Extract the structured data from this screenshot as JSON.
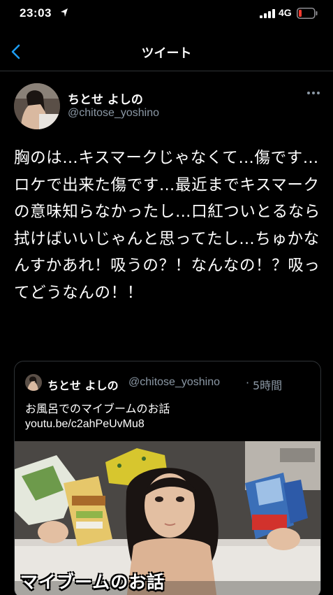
{
  "status_bar": {
    "time": "23:03",
    "network": "4G"
  },
  "nav": {
    "title": "ツイート"
  },
  "tweet": {
    "display_name": "ちとせ よしの",
    "handle": "@chitose_yoshino",
    "text": "胸のは…キスマークじゃなくて…傷です…ロケで出来た傷です…最近までキスマークの意味知らなかったし…口紅ついとるなら拭けばいいじゃんと思ってたし…ちゅかなんすかあれ！吸うの？！なんなの！？吸ってどうなんの！！"
  },
  "quote": {
    "display_name": "ちとせ よしの",
    "handle": "@chitose_yoshino",
    "separator": "·",
    "time": "5時間",
    "text": "お風呂でのマイブームのお話",
    "link": "youtu.be/c2ahPeUvMu8",
    "media_caption": "マイブームのお話"
  },
  "colors": {
    "background": "#000000",
    "text": "#ffffff",
    "secondary_text": "#8b98a5",
    "accent": "#1d9bf0",
    "divider": "#2f3336",
    "battery_low": "#ff3b30"
  }
}
